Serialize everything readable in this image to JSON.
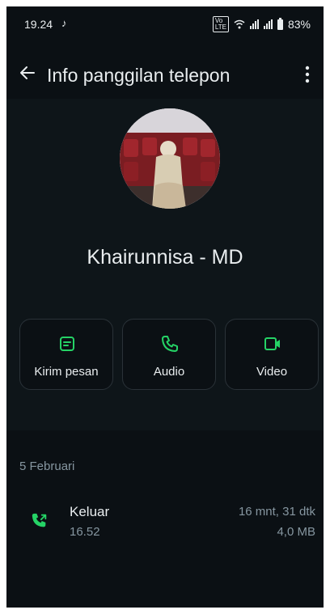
{
  "status_bar": {
    "time": "19.24",
    "battery": "83%"
  },
  "appbar": {
    "title": "Info panggilan telepon"
  },
  "contact": {
    "name": "Khairunnisa - MD"
  },
  "actions": [
    {
      "label": "Kirim pesan",
      "icon": "message-icon"
    },
    {
      "label": "Audio",
      "icon": "phone-icon"
    },
    {
      "label": "Video",
      "icon": "video-icon"
    }
  ],
  "call_log": {
    "date": "5 Februari",
    "entries": [
      {
        "type": "Keluar",
        "time": "16.52",
        "duration": "16 mnt, 31 dtk",
        "size": "4,0 MB"
      }
    ]
  },
  "colors": {
    "accent": "#25d366",
    "background": "#0b1014",
    "text": "#e9edef",
    "secondary": "#8696a0"
  }
}
